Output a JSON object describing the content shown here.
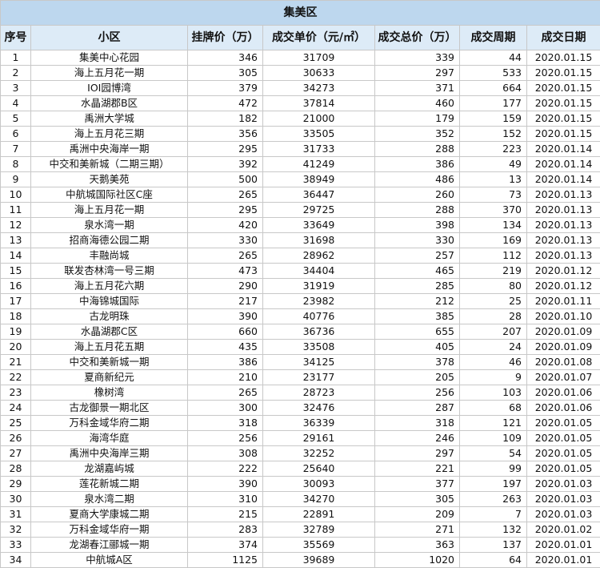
{
  "title": "集美区",
  "headers": [
    "序号",
    "小区",
    "挂牌价（万）",
    "成交单价（元/㎡）",
    "成交总价（万）",
    "成交周期",
    "成交日期"
  ],
  "rows": [
    [
      "1",
      "集美中心花园",
      "346",
      "31709",
      "339",
      "44",
      "2020.01.15"
    ],
    [
      "2",
      "海上五月花一期",
      "305",
      "30633",
      "297",
      "533",
      "2020.01.15"
    ],
    [
      "3",
      "IOI园博湾",
      "379",
      "34273",
      "371",
      "664",
      "2020.01.15"
    ],
    [
      "4",
      "水晶湖郡B区",
      "472",
      "37814",
      "460",
      "177",
      "2020.01.15"
    ],
    [
      "5",
      "禹洲大学城",
      "182",
      "21000",
      "179",
      "159",
      "2020.01.15"
    ],
    [
      "6",
      "海上五月花三期",
      "356",
      "33505",
      "352",
      "152",
      "2020.01.15"
    ],
    [
      "7",
      "禹洲中央海岸一期",
      "295",
      "31733",
      "288",
      "223",
      "2020.01.14"
    ],
    [
      "8",
      "中交和美新城（二期三期）",
      "392",
      "41249",
      "386",
      "49",
      "2020.01.14"
    ],
    [
      "9",
      "天鹅美苑",
      "500",
      "38949",
      "486",
      "13",
      "2020.01.14"
    ],
    [
      "10",
      "中航城国际社区C座",
      "265",
      "36447",
      "260",
      "73",
      "2020.01.13"
    ],
    [
      "11",
      "海上五月花一期",
      "295",
      "29725",
      "288",
      "370",
      "2020.01.13"
    ],
    [
      "12",
      "泉水湾一期",
      "420",
      "33649",
      "398",
      "134",
      "2020.01.13"
    ],
    [
      "13",
      "招商海德公园二期",
      "330",
      "31698",
      "330",
      "169",
      "2020.01.13"
    ],
    [
      "14",
      "丰融尚城",
      "265",
      "28962",
      "257",
      "112",
      "2020.01.13"
    ],
    [
      "15",
      "联发杏林湾一号三期",
      "473",
      "34404",
      "465",
      "219",
      "2020.01.12"
    ],
    [
      "16",
      "海上五月花六期",
      "290",
      "31919",
      "285",
      "80",
      "2020.01.12"
    ],
    [
      "17",
      "中海锦城国际",
      "217",
      "23982",
      "212",
      "25",
      "2020.01.11"
    ],
    [
      "18",
      "古龙明珠",
      "390",
      "40776",
      "385",
      "28",
      "2020.01.10"
    ],
    [
      "19",
      "水晶湖郡C区",
      "660",
      "36736",
      "655",
      "207",
      "2020.01.09"
    ],
    [
      "20",
      "海上五月花五期",
      "435",
      "33508",
      "405",
      "24",
      "2020.01.09"
    ],
    [
      "21",
      "中交和美新城一期",
      "386",
      "34125",
      "378",
      "46",
      "2020.01.08"
    ],
    [
      "22",
      "夏商新纪元",
      "210",
      "23177",
      "205",
      "9",
      "2020.01.07"
    ],
    [
      "23",
      "橡树湾",
      "265",
      "28723",
      "256",
      "103",
      "2020.01.06"
    ],
    [
      "24",
      "古龙御景一期北区",
      "300",
      "32476",
      "287",
      "68",
      "2020.01.06"
    ],
    [
      "25",
      "万科金域华府二期",
      "318",
      "36339",
      "318",
      "121",
      "2020.01.05"
    ],
    [
      "26",
      "海湾华庭",
      "256",
      "29161",
      "246",
      "109",
      "2020.01.05"
    ],
    [
      "27",
      "禹洲中央海岸三期",
      "308",
      "32252",
      "297",
      "54",
      "2020.01.05"
    ],
    [
      "28",
      "龙湖嘉屿城",
      "222",
      "25640",
      "221",
      "99",
      "2020.01.05"
    ],
    [
      "29",
      "莲花新城二期",
      "390",
      "30093",
      "377",
      "197",
      "2020.01.03"
    ],
    [
      "30",
      "泉水湾二期",
      "310",
      "34270",
      "305",
      "263",
      "2020.01.03"
    ],
    [
      "31",
      "夏商大学康城二期",
      "215",
      "22891",
      "209",
      "7",
      "2020.01.03"
    ],
    [
      "32",
      "万科金域华府一期",
      "283",
      "32789",
      "271",
      "132",
      "2020.01.02"
    ],
    [
      "33",
      "龙湖春江郦城一期",
      "374",
      "35569",
      "363",
      "137",
      "2020.01.01"
    ],
    [
      "34",
      "中航城A区",
      "1125",
      "39689",
      "1020",
      "64",
      "2020.01.01"
    ]
  ],
  "colors": {
    "title_bg": "#bdd7ee",
    "header_bg": "#ddebf7",
    "grid": "#c8c8c8"
  }
}
